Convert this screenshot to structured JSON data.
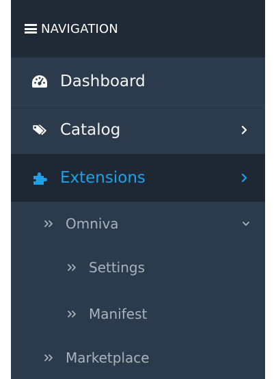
{
  "navigation": {
    "header": "NAVIGATION",
    "items": [
      {
        "label": "Dashboard",
        "icon": "dashboard-gauge-icon"
      },
      {
        "label": "Catalog",
        "icon": "tags-icon"
      },
      {
        "label": "Extensions",
        "icon": "puzzle-piece-icon",
        "active": true
      }
    ],
    "submenu": [
      {
        "label": "Omniva",
        "expanded": true
      },
      {
        "label": "Settings",
        "level": 2
      },
      {
        "label": "Manifest",
        "level": 2
      },
      {
        "label": "Marketplace"
      }
    ]
  },
  "colors": {
    "sidebar_bg": "#2b3b4b",
    "header_bg": "#1f2a36",
    "active_bg": "#1d2834",
    "active_text": "#1ea1e6",
    "sub_text": "#a9b3bd"
  }
}
